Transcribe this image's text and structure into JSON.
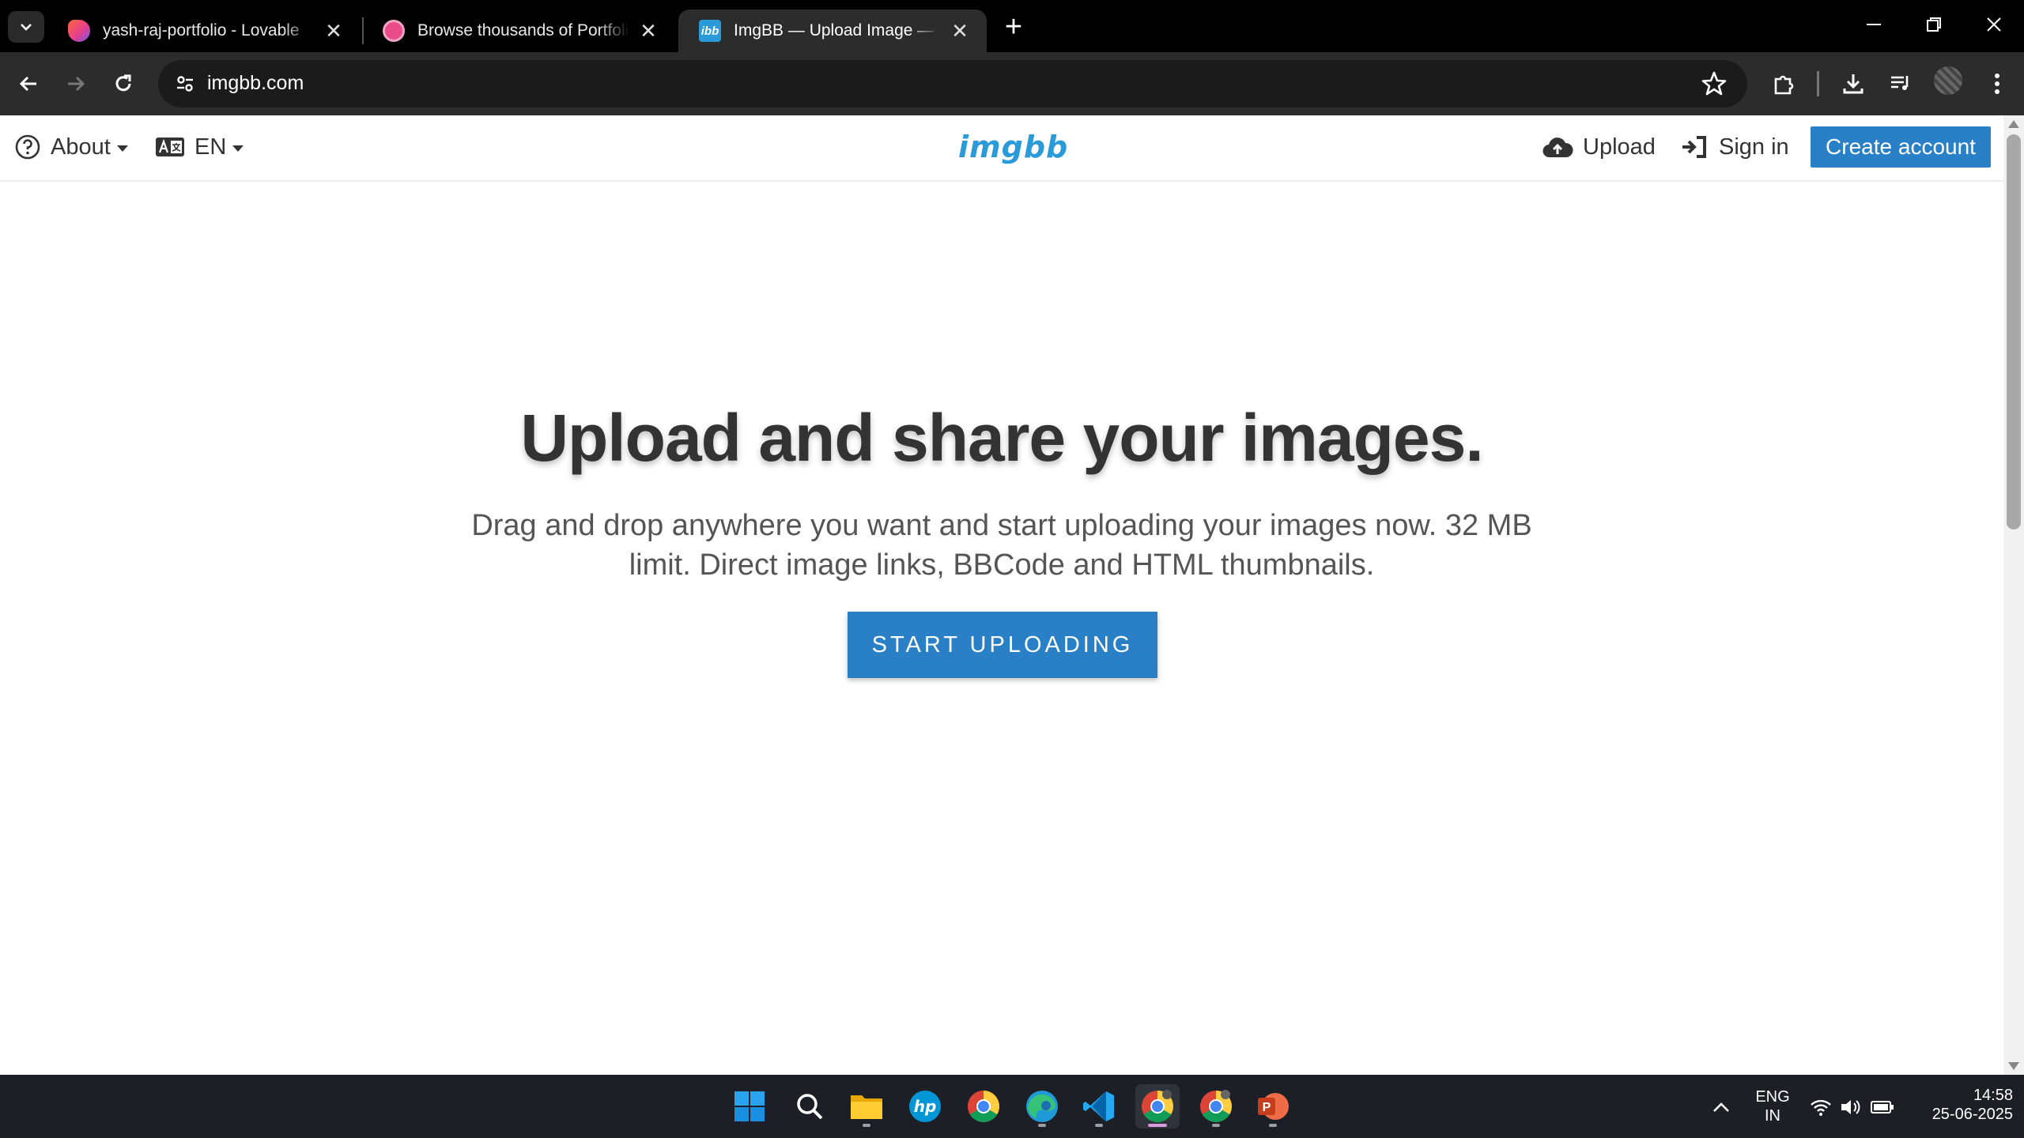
{
  "browser": {
    "tabs": [
      {
        "title": "yash-raj-portfolio - Lovable",
        "active": false
      },
      {
        "title": "Browse thousands of Portfolio Website",
        "active": false
      },
      {
        "title": "ImgBB — Upload Image — Free Image Hosting",
        "active": true
      }
    ],
    "url": "imgbb.com",
    "colors": {
      "frame": "#000000",
      "toolbar": "#2c2c2c",
      "omnibox": "#1b1b1b"
    }
  },
  "site": {
    "nav": {
      "about_label": "About",
      "language_label": "EN",
      "logo_text": "imgbb",
      "upload_label": "Upload",
      "signin_label": "Sign in",
      "create_account_label": "Create account"
    },
    "hero": {
      "title": "Upload and share your images.",
      "subtitle": "Drag and drop anywhere you want and start uploading your images now. 32 MB limit. Direct image links, BBCode and HTML thumbnails.",
      "cta_label": "START UPLOADING"
    },
    "colors": {
      "brand": "#2a9ad9",
      "button": "#2a80c6",
      "text": "#333333"
    }
  },
  "taskbar": {
    "apps": [
      "windows-start",
      "search",
      "file-explorer",
      "hp",
      "chrome",
      "edge",
      "vscode",
      "chrome-profile-active",
      "chrome-profile-2",
      "powerpoint"
    ],
    "language": {
      "line1": "ENG",
      "line2": "IN"
    },
    "clock": {
      "time": "14:58",
      "date": "25-06-2025"
    }
  }
}
